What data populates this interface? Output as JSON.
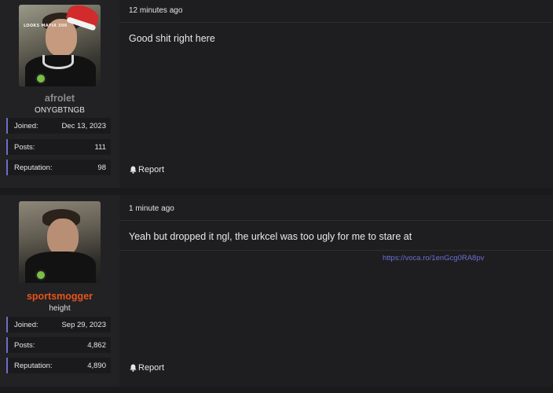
{
  "posts": [
    {
      "user": {
        "avatar_caption": "LOOKS MAFIA 300",
        "username": "afrolet",
        "username_color": "#8b8b8b",
        "title": "ONYGBTNGB",
        "stats": [
          {
            "label": "Joined:",
            "value": "Dec 13, 2023"
          },
          {
            "label": "Posts:",
            "value": "111"
          },
          {
            "label": "Reputation:",
            "value": "98"
          }
        ],
        "online": true
      },
      "timestamp": "12 minutes ago",
      "message": "Good shit right here",
      "signature_link": "",
      "report_label": "Report"
    },
    {
      "user": {
        "username": "sportsmogger",
        "username_color": "#e8541c",
        "title": "height",
        "stats": [
          {
            "label": "Joined:",
            "value": "Sep 29, 2023"
          },
          {
            "label": "Posts:",
            "value": "4,862"
          },
          {
            "label": "Reputation:",
            "value": "4,890"
          }
        ],
        "online": true
      },
      "timestamp": "1 minute ago",
      "message": "Yeah but dropped it ngl, the urkcel was too ugly for me to stare at",
      "signature_link": "https://voca.ro/1enGcg0RA8pv",
      "report_label": "Report"
    }
  ],
  "colors": {
    "accent": "#6b6fc9",
    "online": "#7ac043",
    "link": "#6a6fd0"
  }
}
